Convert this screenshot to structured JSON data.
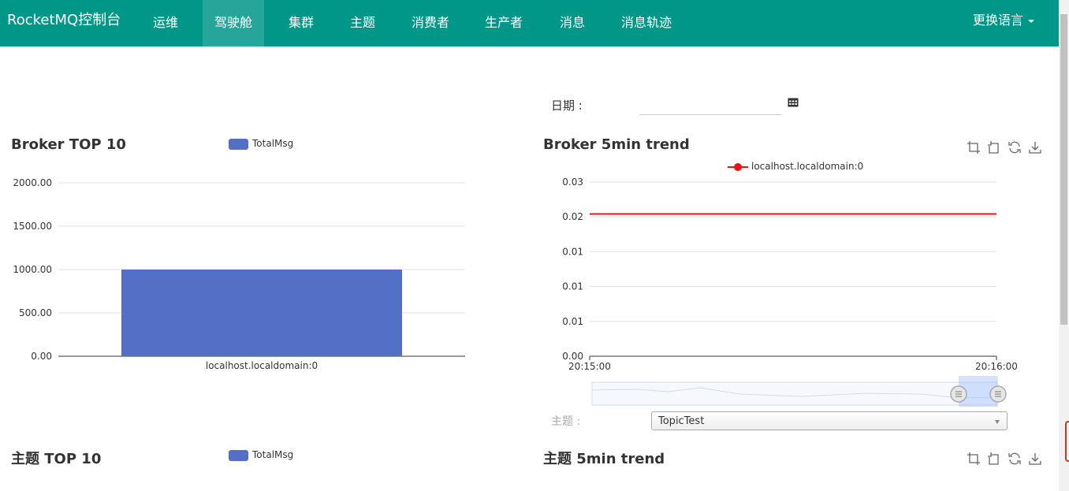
{
  "app": {
    "brand": "RocketMQ控制台",
    "nav": [
      {
        "label": "运维",
        "active": false
      },
      {
        "label": "驾驶舱",
        "active": true
      },
      {
        "label": "集群",
        "active": false
      },
      {
        "label": "主题",
        "active": false
      },
      {
        "label": "消费者",
        "active": false
      },
      {
        "label": "生产者",
        "active": false
      },
      {
        "label": "消息",
        "active": false
      },
      {
        "label": "消息轨迹",
        "active": false
      }
    ],
    "language_menu": "更换语言"
  },
  "filters": {
    "date_label": "日期 :",
    "date_value": "",
    "topic_label": "主题 :",
    "topic_selected": "TopicTest"
  },
  "colors": {
    "navbar": "#009688",
    "nav_active": "#26a69a",
    "bar": "#5470c6",
    "trend_line": "#ee1111"
  },
  "panels": {
    "broker_top": {
      "title": "Broker TOP 10",
      "legend": "TotalMsg"
    },
    "broker_trend": {
      "title": "Broker 5min trend",
      "legend": "localhost.localdomain:0"
    },
    "topic_top": {
      "title": "主题 TOP 10",
      "legend": "TotalMsg"
    },
    "topic_trend": {
      "title": "主题 5min trend"
    }
  },
  "toolbox_icons": [
    "zoom-icon",
    "zoom-reset-icon",
    "restore-icon",
    "save-image-icon"
  ],
  "chart_data": [
    {
      "type": "bar",
      "title": "Broker TOP 10",
      "categories": [
        "localhost.localdomain:0"
      ],
      "series": [
        {
          "name": "TotalMsg",
          "values": [
            1000
          ]
        }
      ],
      "ylim": [
        0,
        2000
      ],
      "yticks": [
        "0.00",
        "500.00",
        "1000.00",
        "1500.00",
        "2000.00"
      ],
      "legend": "top-center",
      "grid": true
    },
    {
      "type": "line",
      "title": "Broker 5min trend",
      "x": [
        "20:15:00",
        "20:16:00"
      ],
      "series": [
        {
          "name": "localhost.localdomain:0",
          "values": [
            0.0245,
            0.0245
          ]
        }
      ],
      "ylim": [
        0,
        0.03
      ],
      "yticks": [
        "0.00",
        "0.01",
        "0.01",
        "0.01",
        "0.02",
        "0.03"
      ],
      "legend": "top-center",
      "grid": true,
      "datazoom": true
    }
  ]
}
